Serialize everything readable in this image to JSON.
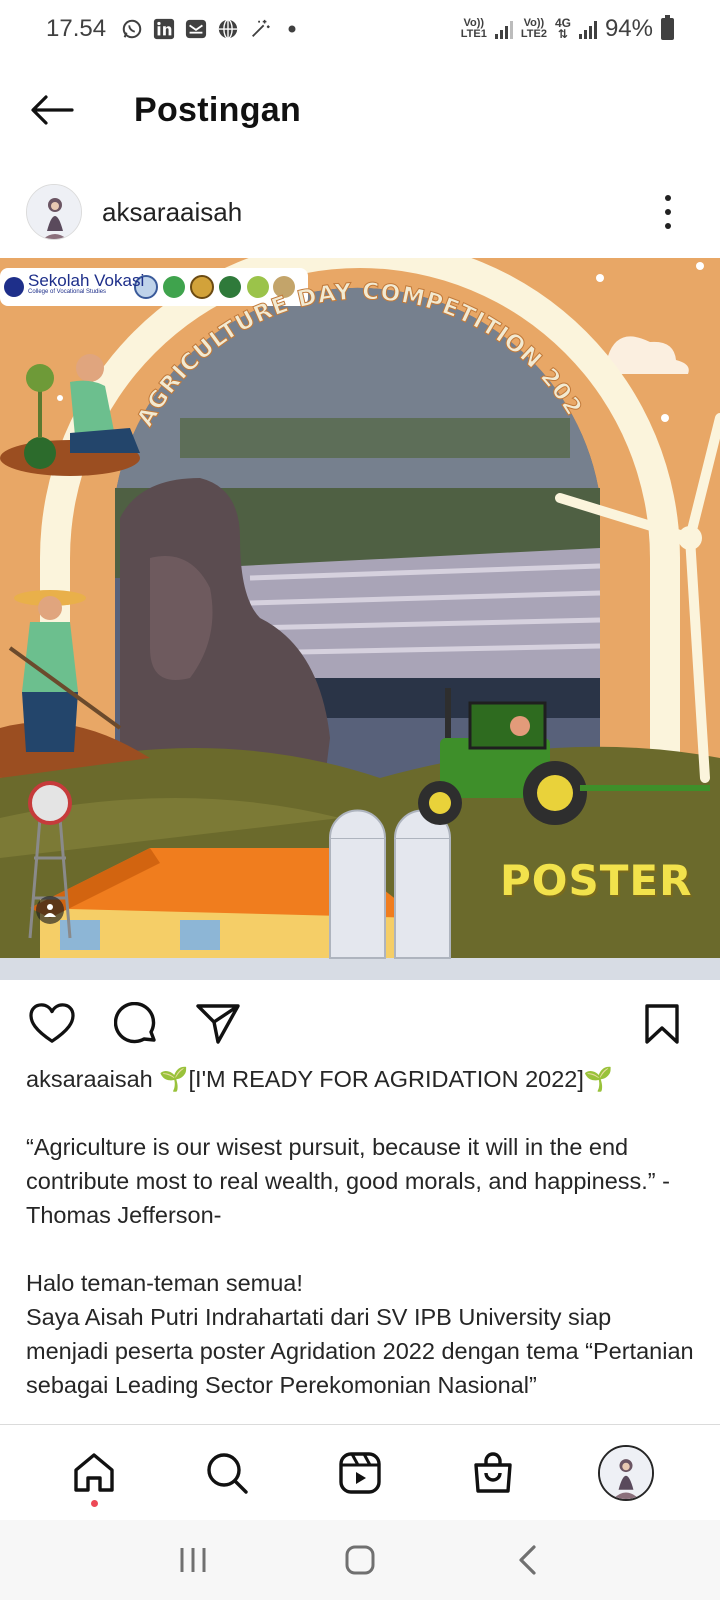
{
  "status_bar": {
    "time": "17.54",
    "battery": "94%",
    "sim1_label_top": "Vo))",
    "sim1_label_bottom": "LTE1",
    "sim2_label_top": "Vo))",
    "sim2_label_bottom": "LTE2",
    "net_type": "4G",
    "left_icons": [
      "whatsapp-icon",
      "linkedin-icon",
      "mail-app-icon",
      "globe-icon",
      "magic-wand-icon",
      "dot-icon"
    ]
  },
  "header": {
    "title": "Postingan"
  },
  "post": {
    "username": "aksaraaisah",
    "image": {
      "logo_text": "Sekolah Vokasi",
      "logo_subtext": "College of Vocational Studies",
      "arc_title": "AGRICULTURE DAY COMPETITION 2022",
      "badge_text": "POSTER",
      "colors": {
        "background": "#E8A766",
        "hill": "#6B6A2C",
        "roof": "#F07D1E",
        "tractor": "#3E8F2A",
        "badge": "#F2E24C"
      }
    },
    "caption": {
      "username": "aksaraaisah",
      "headline": "🌱[I'M READY FOR AGRIDATION 2022]🌱",
      "quote": "“Agriculture is our wisest pursuit, because it will in the end contribute most to real wealth, good morals, and happiness.” -Thomas Jefferson-",
      "greeting": "Halo teman-teman semua!",
      "body": "Saya Aisah Putri Indrahartati dari SV IPB University siap menjadi peserta poster Agridation 2022 dengan tema “Pertanian sebagai Leading Sector Perekomonian Nasional”"
    }
  },
  "bottom_nav": {
    "items": [
      "home-icon",
      "search-icon",
      "reels-icon",
      "shop-icon",
      "profile-avatar"
    ]
  },
  "system_nav": {
    "items": [
      "recents-icon",
      "home-button-icon",
      "back-icon"
    ]
  }
}
